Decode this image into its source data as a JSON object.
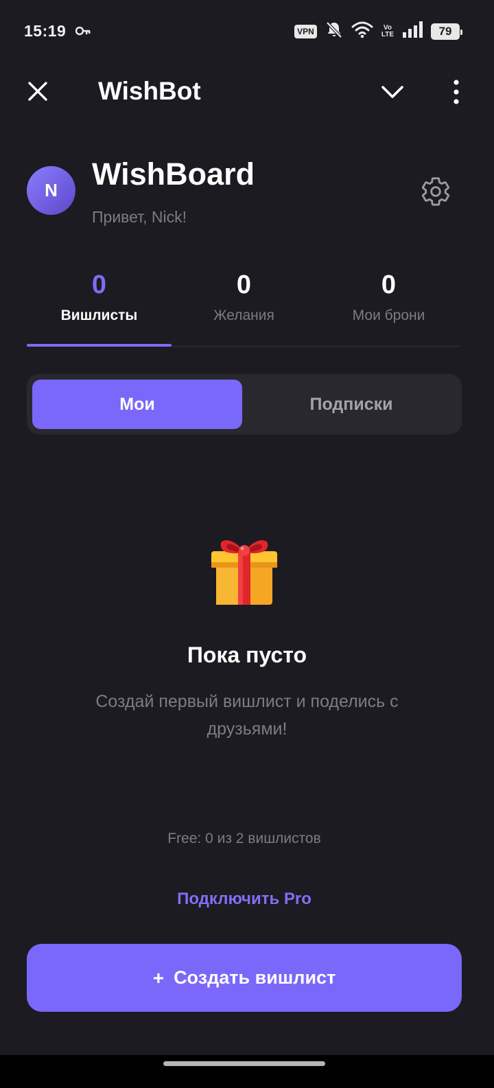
{
  "status_bar": {
    "time": "15:19",
    "vpn": "VPN",
    "volte_top": "Vo",
    "volte_bottom": "LTE",
    "battery": "79",
    "icons": [
      "key-icon",
      "mute-bell-icon",
      "wifi-icon",
      "signal-icon",
      "battery-icon"
    ]
  },
  "header": {
    "title": "WishBot",
    "icons": [
      "close-icon",
      "chevron-down-icon",
      "more-vertical-icon"
    ]
  },
  "profile": {
    "avatar_initial": "N",
    "brand": "WishBoard",
    "greeting": "Привет, Nick!"
  },
  "stats": [
    {
      "value": "0",
      "label": "Вишлисты",
      "active": true
    },
    {
      "value": "0",
      "label": "Желания",
      "active": false
    },
    {
      "value": "0",
      "label": "Мои брони",
      "active": false
    }
  ],
  "segments": {
    "mine": "Мои",
    "subscriptions": "Подписки",
    "selected": "mine"
  },
  "empty_state": {
    "icon": "gift-icon",
    "title": "Пока пусто",
    "text": "Создай первый вишлист и поделись с друзьями!"
  },
  "quota": "Free: 0 из 2 вишлистов",
  "pro_link": "Подключить Pro",
  "create_button": {
    "plus": "+",
    "label": "Создать вишлист"
  },
  "colors": {
    "background": "#1c1b21",
    "accent": "#7a68fb",
    "muted_text": "#7c7c86",
    "surface": "#29282f"
  }
}
